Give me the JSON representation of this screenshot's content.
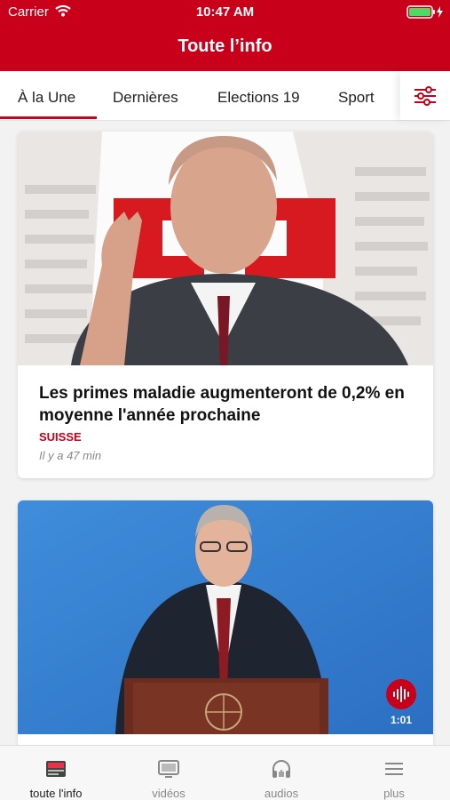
{
  "status_bar": {
    "carrier": "Carrier",
    "time": "10:47 AM"
  },
  "header": {
    "title": "Toute l’info"
  },
  "tabs": [
    {
      "label": "À la Une",
      "active": true
    },
    {
      "label": "Dernières",
      "active": false
    },
    {
      "label": "Elections 19",
      "active": false
    },
    {
      "label": "Sport",
      "active": false
    }
  ],
  "filter_icon": "sliders-icon",
  "articles": [
    {
      "headline": "Les primes maladie augmenteront de 0,2% en moyenne l'année prochaine",
      "category": "SUISSE",
      "time_ago": "Il y a 47 min"
    },
    {
      "duration": "1:01",
      "media_icon": "audio-wave-icon"
    }
  ],
  "bottom_nav": [
    {
      "label": "toute l'info",
      "icon": "news-icon",
      "active": true
    },
    {
      "label": "vidéos",
      "icon": "tv-icon",
      "active": false
    },
    {
      "label": "audios",
      "icon": "headphones-icon",
      "active": false
    },
    {
      "label": "plus",
      "icon": "menu-icon",
      "active": false
    }
  ],
  "colors": {
    "brand": "#c8001a",
    "accent_green": "#4cd964"
  }
}
